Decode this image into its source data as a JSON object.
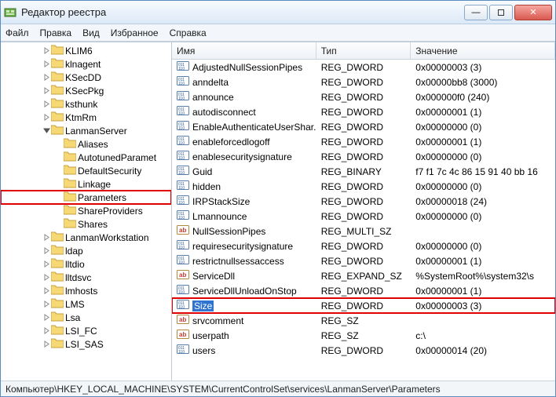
{
  "window": {
    "title": "Редактор реестра"
  },
  "menu": [
    "Файл",
    "Правка",
    "Вид",
    "Избранное",
    "Справка"
  ],
  "tree": [
    {
      "depth": 3,
      "exp": "closed",
      "label": "KLIM6"
    },
    {
      "depth": 3,
      "exp": "closed",
      "label": "klnagent"
    },
    {
      "depth": 3,
      "exp": "closed",
      "label": "KSecDD"
    },
    {
      "depth": 3,
      "exp": "closed",
      "label": "KSecPkg"
    },
    {
      "depth": 3,
      "exp": "closed",
      "label": "ksthunk"
    },
    {
      "depth": 3,
      "exp": "closed",
      "label": "KtmRm"
    },
    {
      "depth": 3,
      "exp": "open",
      "label": "LanmanServer"
    },
    {
      "depth": 4,
      "exp": "none",
      "label": "Aliases"
    },
    {
      "depth": 4,
      "exp": "none",
      "label": "AutotunedParamet"
    },
    {
      "depth": 4,
      "exp": "none",
      "label": "DefaultSecurity"
    },
    {
      "depth": 4,
      "exp": "none",
      "label": "Linkage"
    },
    {
      "depth": 4,
      "exp": "none",
      "label": "Parameters",
      "highlight": true
    },
    {
      "depth": 4,
      "exp": "none",
      "label": "ShareProviders"
    },
    {
      "depth": 4,
      "exp": "none",
      "label": "Shares"
    },
    {
      "depth": 3,
      "exp": "closed",
      "label": "LanmanWorkstation"
    },
    {
      "depth": 3,
      "exp": "closed",
      "label": "ldap"
    },
    {
      "depth": 3,
      "exp": "closed",
      "label": "lltdio"
    },
    {
      "depth": 3,
      "exp": "closed",
      "label": "lltdsvc"
    },
    {
      "depth": 3,
      "exp": "closed",
      "label": "lmhosts"
    },
    {
      "depth": 3,
      "exp": "closed",
      "label": "LMS"
    },
    {
      "depth": 3,
      "exp": "closed",
      "label": "Lsa"
    },
    {
      "depth": 3,
      "exp": "closed",
      "label": "LSI_FC"
    },
    {
      "depth": 3,
      "exp": "closed",
      "label": "LSI_SAS"
    }
  ],
  "columns": {
    "name": "Имя",
    "type": "Тип",
    "data": "Значение"
  },
  "values": [
    {
      "ico": "bin",
      "name": "AdjustedNullSessionPipes",
      "type": "REG_DWORD",
      "data": "0x00000003 (3)"
    },
    {
      "ico": "bin",
      "name": "anndelta",
      "type": "REG_DWORD",
      "data": "0x00000bb8 (3000)"
    },
    {
      "ico": "bin",
      "name": "announce",
      "type": "REG_DWORD",
      "data": "0x000000f0 (240)"
    },
    {
      "ico": "bin",
      "name": "autodisconnect",
      "type": "REG_DWORD",
      "data": "0x00000001 (1)"
    },
    {
      "ico": "bin",
      "name": "EnableAuthenticateUserShar...",
      "type": "REG_DWORD",
      "data": "0x00000000 (0)"
    },
    {
      "ico": "bin",
      "name": "enableforcedlogoff",
      "type": "REG_DWORD",
      "data": "0x00000001 (1)"
    },
    {
      "ico": "bin",
      "name": "enablesecuritysignature",
      "type": "REG_DWORD",
      "data": "0x00000000 (0)"
    },
    {
      "ico": "bin",
      "name": "Guid",
      "type": "REG_BINARY",
      "data": "f7 f1 7c 4c 86 15 91 40 bb 16"
    },
    {
      "ico": "bin",
      "name": "hidden",
      "type": "REG_DWORD",
      "data": "0x00000000 (0)"
    },
    {
      "ico": "bin",
      "name": "IRPStackSize",
      "type": "REG_DWORD",
      "data": "0x00000018 (24)"
    },
    {
      "ico": "bin",
      "name": "Lmannounce",
      "type": "REG_DWORD",
      "data": "0x00000000 (0)"
    },
    {
      "ico": "str",
      "name": "NullSessionPipes",
      "type": "REG_MULTI_SZ",
      "data": ""
    },
    {
      "ico": "bin",
      "name": "requiresecuritysignature",
      "type": "REG_DWORD",
      "data": "0x00000000 (0)"
    },
    {
      "ico": "bin",
      "name": "restrictnullsessaccess",
      "type": "REG_DWORD",
      "data": "0x00000001 (1)"
    },
    {
      "ico": "str",
      "name": "ServiceDll",
      "type": "REG_EXPAND_SZ",
      "data": "%SystemRoot%\\system32\\s"
    },
    {
      "ico": "bin",
      "name": "ServiceDllUnloadOnStop",
      "type": "REG_DWORD",
      "data": "0x00000001 (1)"
    },
    {
      "ico": "bin",
      "name": "Size",
      "type": "REG_DWORD",
      "data": "0x00000003 (3)",
      "highlight": true,
      "selected": true
    },
    {
      "ico": "str",
      "name": "srvcomment",
      "type": "REG_SZ",
      "data": ""
    },
    {
      "ico": "str",
      "name": "userpath",
      "type": "REG_SZ",
      "data": "c:\\"
    },
    {
      "ico": "bin",
      "name": "users",
      "type": "REG_DWORD",
      "data": "0x00000014 (20)"
    }
  ],
  "status": "Компьютер\\HKEY_LOCAL_MACHINE\\SYSTEM\\CurrentControlSet\\services\\LanmanServer\\Parameters"
}
